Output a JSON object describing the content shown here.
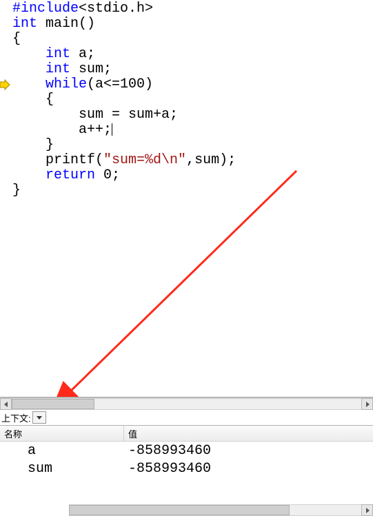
{
  "code": {
    "l1_pre": "#include",
    "l1_hdr": "<stdio.h>",
    "l2_kw": "int",
    "l2_rest": " main()",
    "l3": "{",
    "l4_pad": "    ",
    "l4_kw": "int",
    "l4_rest": " a;",
    "l5_pad": "    ",
    "l5_kw": "int",
    "l5_rest": " sum;",
    "l6_pad": "    ",
    "l6_kw": "while",
    "l6_rest": "(a<=100)",
    "l7": "    {",
    "l8": "        sum = sum+a;",
    "l9": "        a++;",
    "l10": "    }",
    "l11_pad": "    printf(",
    "l11_str": "\"sum=%d\\n\"",
    "l11_rest": ",sum);",
    "l12_pad": "    ",
    "l12_kw": "return",
    "l12_rest": " 0;",
    "l13": "}"
  },
  "context_label": "上下文:",
  "vars": {
    "header_name": "名称",
    "header_value": "值",
    "rows": [
      {
        "name": "a",
        "value": "-858993460"
      },
      {
        "name": "sum",
        "value": "-858993460"
      }
    ]
  }
}
